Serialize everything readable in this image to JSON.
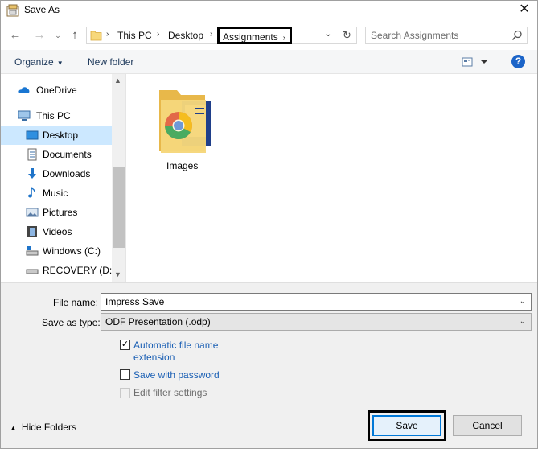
{
  "window": {
    "title": "Save As",
    "close_glyph": "✕"
  },
  "nav_buttons": {
    "back": "←",
    "forward": "→",
    "recent": "⌄",
    "up": "↑"
  },
  "address": {
    "sep": "›",
    "crumbs": [
      "This PC",
      "Desktop",
      "Assignments"
    ],
    "dropdown": "⌄",
    "refresh": "↻"
  },
  "search": {
    "placeholder": "Search Assignments",
    "value": ""
  },
  "toolbar": {
    "organize_label": "Organize",
    "organize_caret": "▼",
    "new_folder_label": "New folder",
    "help_label": "?"
  },
  "sidebar": {
    "scroll_up": "▲",
    "scroll_down": "▼",
    "items": [
      {
        "label": "OneDrive",
        "icon": "cloud-icon"
      },
      {
        "label": "This PC",
        "icon": "computer-icon"
      },
      {
        "label": "Desktop",
        "icon": "desktop-icon",
        "selected": true
      },
      {
        "label": "Documents",
        "icon": "documents-icon"
      },
      {
        "label": "Downloads",
        "icon": "download-arrow-icon"
      },
      {
        "label": "Music",
        "icon": "music-note-icon"
      },
      {
        "label": "Pictures",
        "icon": "pictures-icon"
      },
      {
        "label": "Videos",
        "icon": "film-icon"
      },
      {
        "label": "Windows (C:)",
        "icon": "drive-icon"
      },
      {
        "label": "RECOVERY (D:)",
        "icon": "drive-icon"
      }
    ]
  },
  "content": {
    "items": [
      {
        "label": "Images",
        "icon": "folder-with-chrome-icon"
      }
    ]
  },
  "form": {
    "file_name_label_pre": "File ",
    "file_name_label_ul": "n",
    "file_name_label_post": "ame:",
    "file_name_value": "Impress Save",
    "save_type_label_pre": "Save as ",
    "save_type_label_ul": "t",
    "save_type_label_post": "ype:",
    "save_type_value": "ODF Presentation (.odp)",
    "caret": "⌄",
    "auto_ext_line1": "Automatic file name",
    "auto_ext_line2": "extension",
    "auto_ext_checked": true,
    "check_glyph": "✓",
    "password_label": "Save with password",
    "password_checked": false,
    "filter_label": "Edit filter settings",
    "filter_checked": false
  },
  "footer": {
    "hide_folders_chevron": "▲",
    "hide_folders_label": "Hide Folders",
    "save_label_ul": "S",
    "save_label_post": "ave",
    "cancel_label": "Cancel"
  },
  "colors": {
    "accent": "#0078d7",
    "selected_bg": "#cce8ff",
    "link": "#1a5fb4",
    "help": "#1b64c8"
  }
}
